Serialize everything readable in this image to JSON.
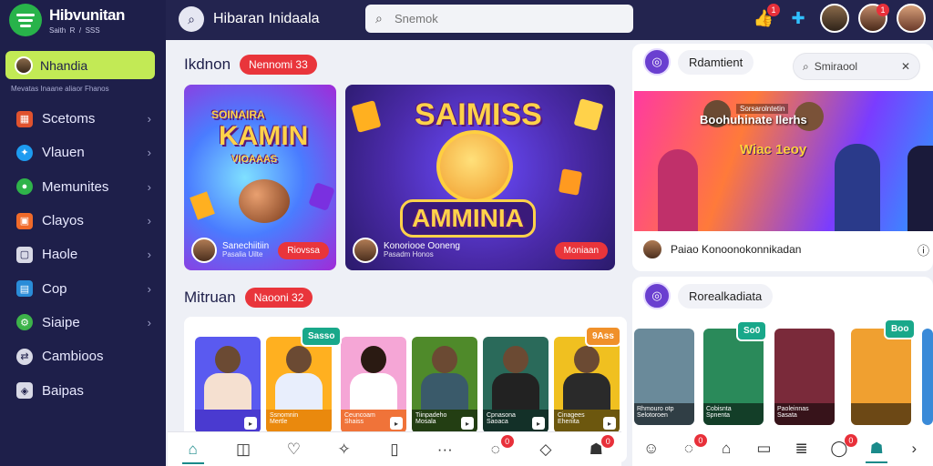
{
  "brand": {
    "title": "Hibvunitan",
    "subtitle": "Saith  R  /  SSS"
  },
  "sidebar": {
    "active": {
      "label": "Nhandia"
    },
    "subtitle": "Mevatas Inaane aliaor Fhanos",
    "items": [
      {
        "label": "Scetoms",
        "icon": "grid-icon",
        "color": "#e0522e"
      },
      {
        "label": "Vlauen",
        "icon": "bird-icon",
        "color": "#1d9bf0"
      },
      {
        "label": "Memunites",
        "icon": "pin-icon",
        "color": "#2fb34a"
      },
      {
        "label": "Clayos",
        "icon": "shop-icon",
        "color": "#f06a2a"
      },
      {
        "label": "Haole",
        "icon": "box-icon",
        "color": "#d8d9e6"
      },
      {
        "label": "Cop",
        "icon": "tile-icon",
        "color": "#2a8cd8"
      },
      {
        "label": "Siaipe",
        "icon": "gear-icon",
        "color": "#3db34a"
      },
      {
        "label": "Cambioos",
        "icon": "swap-icon",
        "color": "#d8d9e6"
      },
      {
        "label": "Baipas",
        "icon": "tag-icon",
        "color": "#d8d9e6"
      }
    ]
  },
  "topbar": {
    "title": "Hibaran Inidaala",
    "search_placeholder": "Snemok",
    "badges": [
      "1",
      "1"
    ]
  },
  "section1": {
    "title": "Ikdnon",
    "pill": "Nennomi 33",
    "card1": {
      "game_title": "KAMIN",
      "game_tagline": "SOINAIRA",
      "game_sub": "VIOAAAS",
      "caption_a": "Sanechiitiin",
      "caption_b": "Pasalia Uilte",
      "button": "Riovssa"
    },
    "card2": {
      "game_title_top": "SAIMISS",
      "game_title": "AMMINIA",
      "caption_a": "Konoriooe Ooneng",
      "caption_b": "Pasadm Honos",
      "button": "Moniaan"
    }
  },
  "section2": {
    "title": "Mitruan",
    "pill": "Naooni 32",
    "tags": [
      "Sasso",
      "9Ass"
    ],
    "people": [
      {
        "name": "",
        "sub": ""
      },
      {
        "name": "Ssnomnin",
        "sub": "Mertle"
      },
      {
        "name": "Ceuncoam",
        "sub": "Shaiss"
      },
      {
        "name": "Tiinpadeho",
        "sub": "Mosala"
      },
      {
        "name": "Cpnasona",
        "sub": "Saoaca"
      },
      {
        "name": "Cinagees",
        "sub": "Ehenita"
      }
    ]
  },
  "right_panel": {
    "card1": {
      "name": "Rdamtient",
      "search_placeholder": "Smiraool",
      "banner_title": "Boohuhinate Ilerhs",
      "banner_sub": "Wiac 1eoy",
      "banner_top_text": "Sorsarolntetin",
      "footer_text": "Paiao Konoonokonnikadan"
    },
    "card2": {
      "name": "Rorealkadiata",
      "tags": [
        "So0",
        "Boo"
      ],
      "thumbs": [
        {
          "name": "Rhmouro otp",
          "sub": "Selotoroen"
        },
        {
          "name": "Cobisnta",
          "sub": "Spnenta"
        },
        {
          "name": "Paoleinnas",
          "sub": "Sasata"
        },
        {
          "name": "",
          "sub": ""
        }
      ]
    }
  },
  "bottom_nav_badges": [
    "0",
    "0",
    "0",
    "0"
  ]
}
